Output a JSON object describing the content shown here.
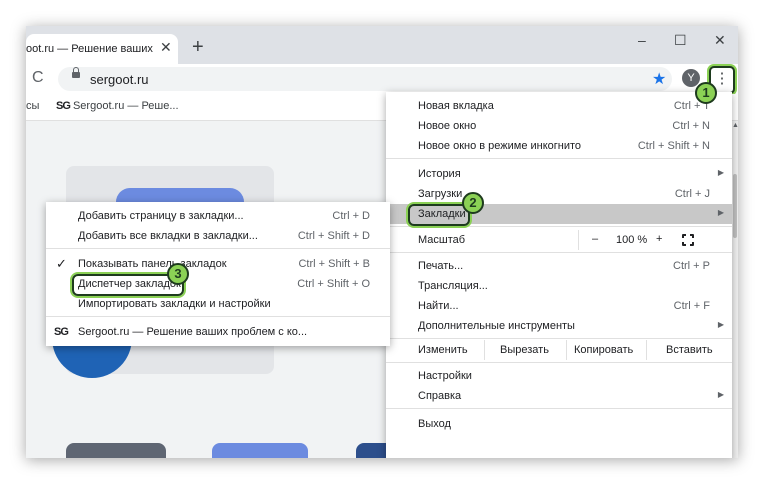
{
  "window": {
    "tab_title": "oot.ru — Решение ваших пр",
    "tab_close": "✕",
    "new_tab": "+",
    "minimize": "–",
    "maximize": "☐",
    "close": "✕"
  },
  "toolbar": {
    "reload": "C",
    "url": "sergoot.ru",
    "star": "★",
    "ext_icon": "Y",
    "menu_icon": "⋮"
  },
  "bookmarks_bar": {
    "cut_label": "сы",
    "logo": "SG",
    "item": "Sergoot.ru — Реше..."
  },
  "chrome_menu": {
    "items": [
      {
        "label": "Новая вкладка",
        "shortcut": "Ctrl + T"
      },
      {
        "label": "Новое окно",
        "shortcut": "Ctrl + N"
      },
      {
        "label": "Новое окно в режиме инкогнито",
        "shortcut": "Ctrl + Shift + N"
      },
      {
        "label": "История",
        "shortcut": ""
      },
      {
        "label": "Загрузки",
        "shortcut": "Ctrl + J"
      },
      {
        "label": "Закладки",
        "shortcut": ""
      },
      {
        "label": "Масштаб",
        "shortcut": ""
      },
      {
        "label": "Печать...",
        "shortcut": "Ctrl + P"
      },
      {
        "label": "Трансляция...",
        "shortcut": ""
      },
      {
        "label": "Найти...",
        "shortcut": "Ctrl + F"
      },
      {
        "label": "Дополнительные инструменты",
        "shortcut": ""
      },
      {
        "label": "Настройки",
        "shortcut": ""
      },
      {
        "label": "Справка",
        "shortcut": ""
      },
      {
        "label": "Выход",
        "shortcut": ""
      }
    ],
    "arrow": "▶",
    "zoom": {
      "minus": "–",
      "value": "100 %",
      "plus": "+"
    },
    "edit": {
      "label": "Изменить",
      "cut": "Вырезать",
      "copy": "Копировать",
      "paste": "Вставить"
    }
  },
  "bookmarks_submenu": {
    "items": [
      {
        "label": "Добавить страницу в закладки...",
        "shortcut": "Ctrl + D"
      },
      {
        "label": "Добавить все вкладки в закладки...",
        "shortcut": "Ctrl + Shift + D"
      },
      {
        "label": "Показывать панель закладок",
        "shortcut": "Ctrl + Shift + B"
      },
      {
        "label": "Диспетчер закладок",
        "shortcut": "Ctrl + Shift + O"
      },
      {
        "label": "Импортировать закладки и настройки",
        "shortcut": ""
      },
      {
        "label": "Sergoot.ru — Решение ваших проблем с ко...",
        "shortcut": ""
      }
    ],
    "check": "✓",
    "logo": "SG"
  },
  "annotations": {
    "step1": "1",
    "step2": "2",
    "step3": "3"
  },
  "colors": {
    "highlight": "#8bd155",
    "highlight_border": "#1e3b1e",
    "accent": "#1a73e8"
  }
}
